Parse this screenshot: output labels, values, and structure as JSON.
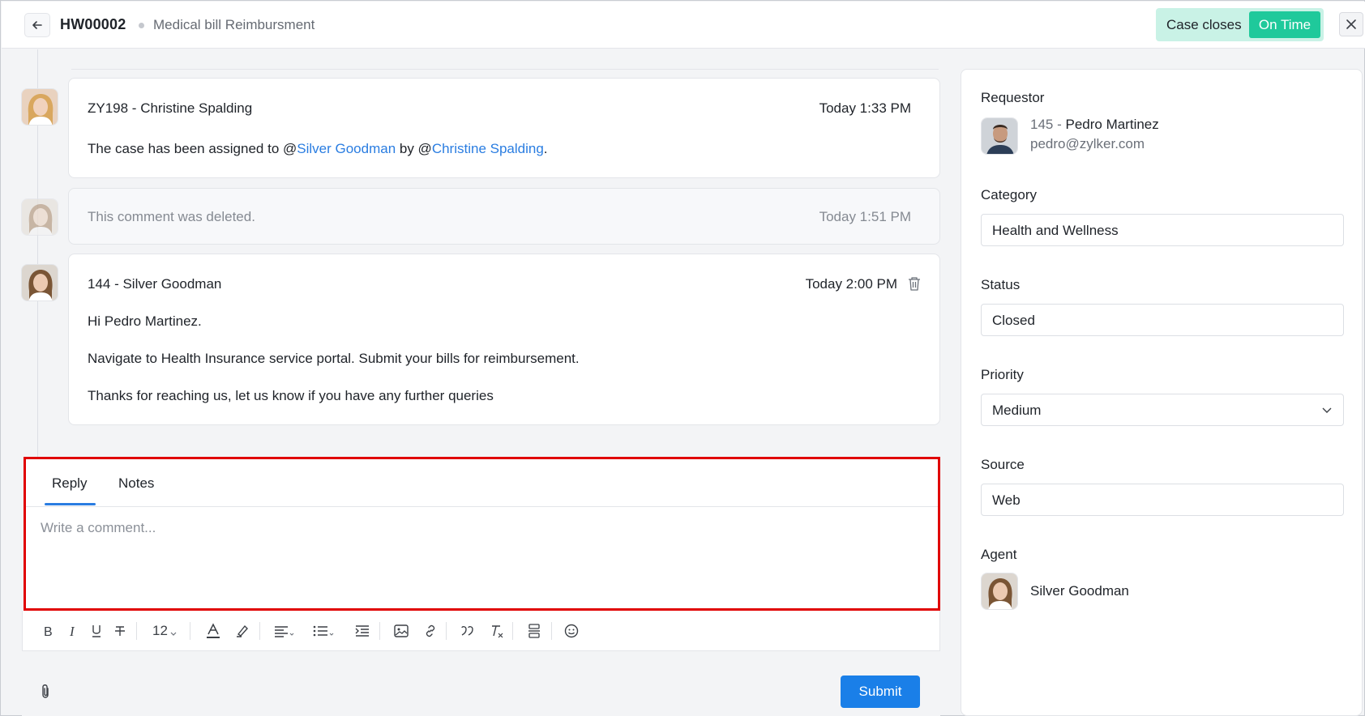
{
  "header": {
    "back_icon": "arrow-left-icon",
    "case_id": "HW00002",
    "case_title": "Medical bill Reimbursment",
    "case_closes_label": "Case closes",
    "case_closes_status": "On Time",
    "close_icon": "close-icon"
  },
  "timeline": [
    {
      "author": "ZY198 - Christine Spalding",
      "time": "Today 1:33 PM",
      "text_prefix": "The case has been assigned to @",
      "mention_1": "Silver Goodman",
      "text_middle": " by @",
      "mention_2": "Christine Spalding",
      "text_suffix": "."
    },
    {
      "text": "This comment was deleted.",
      "time": "Today 1:51 PM"
    },
    {
      "author": "144 - Silver Goodman",
      "time": "Today 2:00 PM",
      "delete_icon": "trash-icon",
      "lines": [
        "Hi Pedro Martinez.",
        "Navigate to Health Insurance service portal. Submit your bills for reimbursement.",
        "Thanks for reaching us, let us know if you have any further queries"
      ]
    }
  ],
  "reply": {
    "tabs": [
      "Reply",
      "Notes"
    ],
    "active_tab": "Reply",
    "placeholder": "Write a comment...",
    "font_size_value": "12",
    "submit_label": "Submit"
  },
  "side": {
    "requestor_label": "Requestor",
    "requestor_id": "145 - ",
    "requestor_name": "Pedro Martinez",
    "requestor_email": "pedro@zylker.com",
    "category_label": "Category",
    "category_value": "Health and Wellness",
    "status_label": "Status",
    "status_value": "Closed",
    "priority_label": "Priority",
    "priority_value": "Medium",
    "source_label": "Source",
    "source_value": "Web",
    "agent_label": "Agent",
    "agent_name": "Silver Goodman"
  },
  "colors": {
    "accent": "#1a7fe8",
    "on_time": "#1fc99b",
    "case_closes_bg": "#c9f2e6",
    "highlight_border": "#e00000"
  }
}
